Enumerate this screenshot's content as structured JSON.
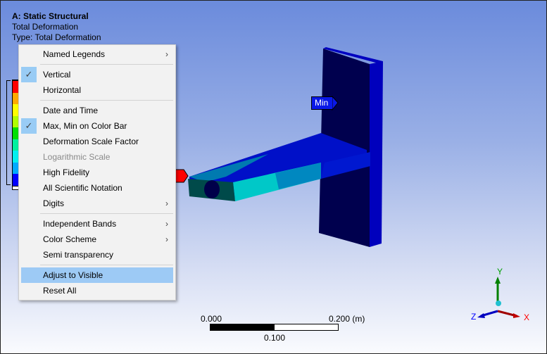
{
  "info": {
    "title": "A: Static Structural",
    "line1": "Total Deformation",
    "line2": "Type: Total Deformation"
  },
  "legend": {
    "colors": [
      "#ff0000",
      "#ffaa00",
      "#ffff00",
      "#b0ff00",
      "#00e000",
      "#00f0a0",
      "#00f0f0",
      "#00aaff",
      "#0000ff"
    ]
  },
  "probe": {
    "min_label": "Min"
  },
  "menu": {
    "items": [
      {
        "label": "Named Legends",
        "submenu": true
      },
      {
        "sep": true
      },
      {
        "label": "Vertical",
        "checked": true
      },
      {
        "label": "Horizontal"
      },
      {
        "sep": true
      },
      {
        "label": "Date and Time"
      },
      {
        "label": "Max, Min on Color Bar",
        "checked": true
      },
      {
        "label": "Deformation Scale Factor"
      },
      {
        "label": "Logarithmic Scale",
        "disabled": true
      },
      {
        "label": "High Fidelity"
      },
      {
        "label": "All Scientific Notation"
      },
      {
        "label": "Digits",
        "submenu": true
      },
      {
        "sep": true
      },
      {
        "label": "Independent Bands",
        "submenu": true
      },
      {
        "label": "Color Scheme",
        "submenu": true
      },
      {
        "label": "Semi transparency"
      },
      {
        "sep": true
      },
      {
        "label": "Adjust to Visible",
        "highlighted": true
      },
      {
        "label": "Reset All"
      }
    ]
  },
  "scale": {
    "left": "0.000",
    "right": "0.200 (m)",
    "mid": "0.100"
  },
  "triad": {
    "x": "X",
    "y": "Y",
    "z": "Z"
  }
}
